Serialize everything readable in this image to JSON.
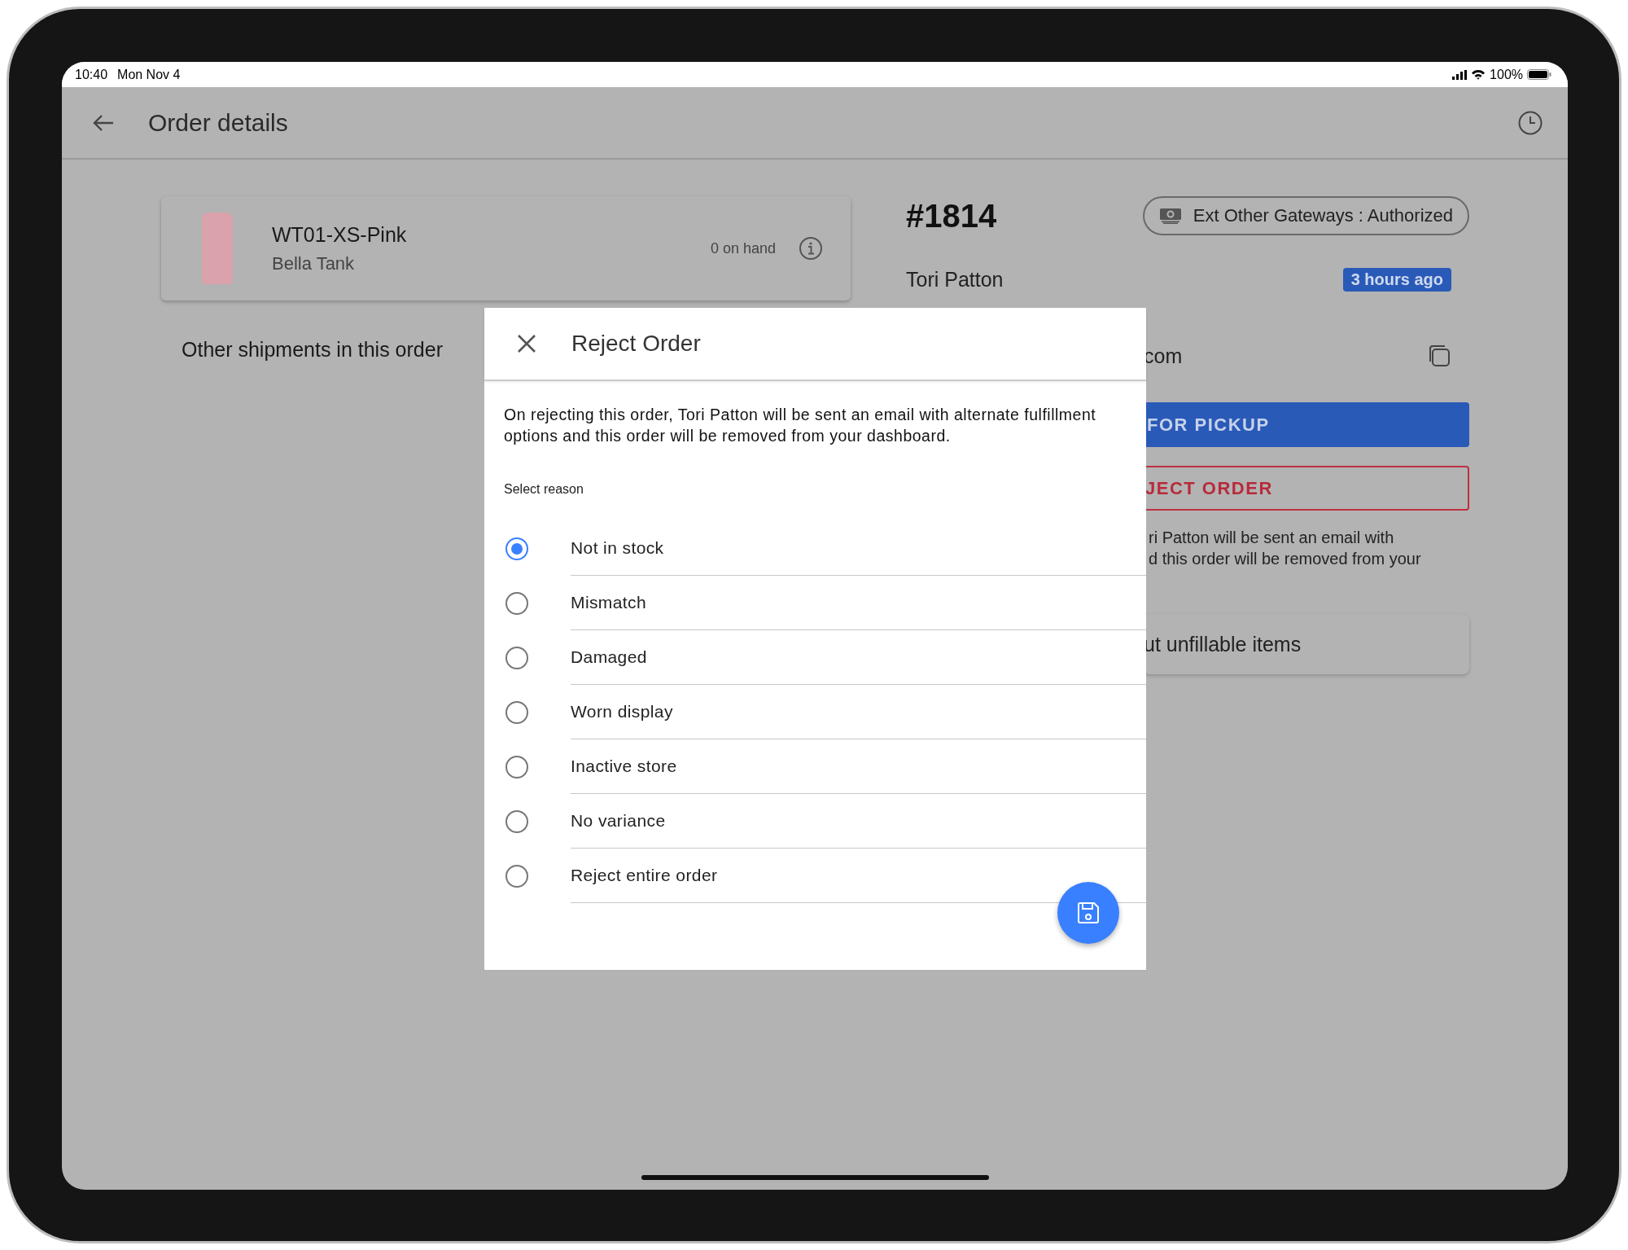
{
  "status_bar": {
    "time": "10:40",
    "date": "Mon Nov 4",
    "battery": "100%"
  },
  "header": {
    "title": "Order details"
  },
  "item": {
    "sku": "WT01-XS-Pink",
    "name": "Bella Tank",
    "stock": "0 on hand"
  },
  "other_shipments": "Other shipments in this order",
  "order": {
    "number": "#1814",
    "payment": "Ext Other Gateways : Authorized",
    "customer": "Tori Patton",
    "age": "3 hours ago",
    "email_fragment": "com",
    "ready_button": "FOR PICKUP",
    "reject_button": "JECT ORDER",
    "reject_note": [
      "ri Patton will be sent an email with",
      "d this order will be removed from your"
    ],
    "unfillable": "ut unfillable items"
  },
  "dialog": {
    "title": "Reject Order",
    "message": "On rejecting this order, Tori Patton will be sent an email with alternate fulfillment options and this order will be removed from your dashboard.",
    "reason_label": "Select reason",
    "reasons": [
      {
        "label": "Not in stock",
        "selected": true
      },
      {
        "label": "Mismatch",
        "selected": false
      },
      {
        "label": "Damaged",
        "selected": false
      },
      {
        "label": "Worn display",
        "selected": false
      },
      {
        "label": "Inactive store",
        "selected": false
      },
      {
        "label": "No variance",
        "selected": false
      },
      {
        "label": "Reject entire order",
        "selected": false
      }
    ]
  }
}
